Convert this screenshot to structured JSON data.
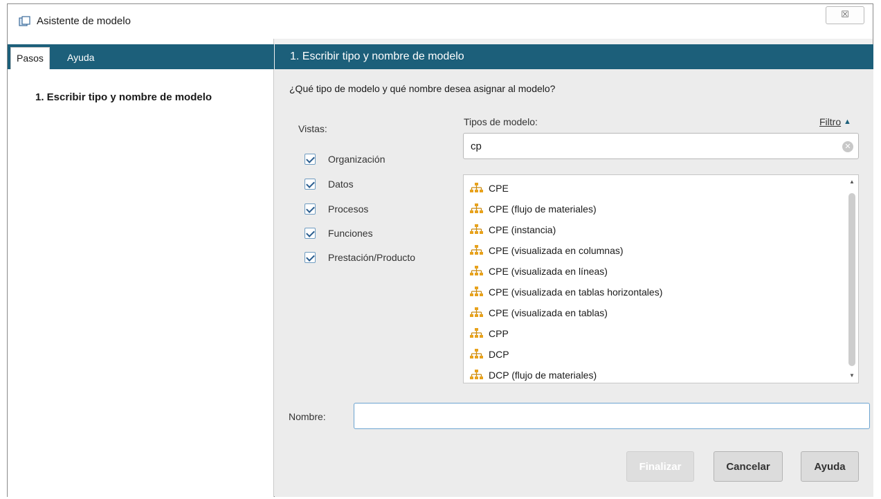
{
  "window": {
    "title": "Asistente de modelo",
    "close_glyph": "☒",
    "icon": "window-icon"
  },
  "left": {
    "tabs": [
      {
        "label": "Pasos",
        "active": true
      },
      {
        "label": "Ayuda",
        "active": false
      }
    ],
    "steps": [
      "1. Escribir tipo y nombre de modelo"
    ]
  },
  "main": {
    "header": "1. Escribir tipo y nombre de modelo",
    "question": "¿Qué tipo de modelo y qué nombre desea asignar al modelo?",
    "vistas_label": "Vistas:",
    "views": [
      {
        "label": "Organización",
        "checked": true
      },
      {
        "label": "Datos",
        "checked": true
      },
      {
        "label": "Procesos",
        "checked": true
      },
      {
        "label": "Funciones",
        "checked": true
      },
      {
        "label": "Prestación/Producto",
        "checked": true
      }
    ],
    "tipos_label": "Tipos de modelo:",
    "filtro_label": "Filtro",
    "search": {
      "value": "cp",
      "placeholder": ""
    },
    "model_types": [
      "CPE",
      "CPE (flujo de materiales)",
      "CPE (instancia)",
      "CPE (visualizada en columnas)",
      "CPE (visualizada en líneas)",
      "CPE (visualizada en tablas horizontales)",
      "CPE (visualizada en tablas)",
      "CPP",
      "DCP",
      "DCP (flujo de materiales)"
    ],
    "nombre_label": "Nombre:",
    "nombre_value": ""
  },
  "buttons": {
    "finalizar": "Finalizar",
    "cancelar": "Cancelar",
    "ayuda": "Ayuda"
  },
  "colors": {
    "header_bg": "#1c5f7a",
    "tree_icon": "#e8a21c"
  }
}
